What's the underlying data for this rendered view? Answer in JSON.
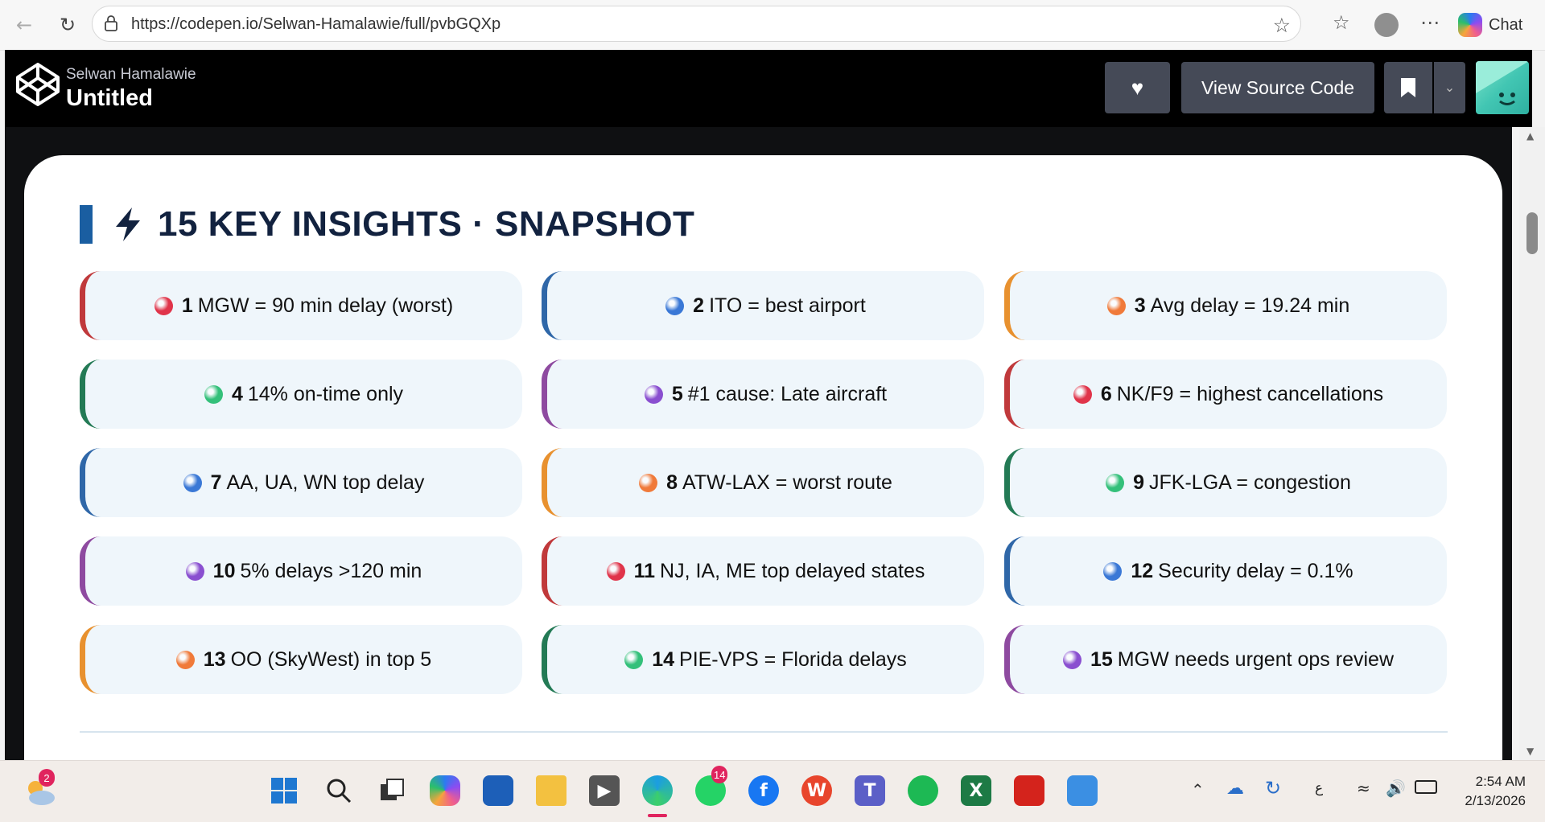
{
  "browser": {
    "url": "https://codepen.io/Selwan-Hamalawie/full/pvbGQXp",
    "chat_label": "Chat"
  },
  "codepen": {
    "author": "Selwan Hamalawie",
    "title": "Untitled",
    "view_source_label": "View Source Code"
  },
  "insights": {
    "heading": "15 KEY INSIGHTS · SNAPSHOT",
    "items": [
      {
        "num": "1",
        "text": "MGW = 90 min delay (worst)",
        "color": "#e0344a"
      },
      {
        "num": "2",
        "text": "ITO = best airport",
        "color": "#3a78d6"
      },
      {
        "num": "3",
        "text": "Avg delay = 19.24 min",
        "color": "#f07a3a"
      },
      {
        "num": "4",
        "text": "14% on-time only",
        "color": "#34c07a"
      },
      {
        "num": "5",
        "text": "#1 cause: Late aircraft",
        "color": "#8a4fd0"
      },
      {
        "num": "6",
        "text": "NK/F9 = highest cancellations",
        "color": "#e0344a"
      },
      {
        "num": "7",
        "text": "AA, UA, WN top delay",
        "color": "#3a78d6"
      },
      {
        "num": "8",
        "text": "ATW-LAX = worst route",
        "color": "#f07a3a"
      },
      {
        "num": "9",
        "text": "JFK-LGA = congestion",
        "color": "#34c07a"
      },
      {
        "num": "10",
        "text": "5% delays >120 min",
        "color": "#8a4fd0"
      },
      {
        "num": "11",
        "text": "NJ, IA, ME top delayed states",
        "color": "#e0344a"
      },
      {
        "num": "12",
        "text": "Security delay = 0.1%",
        "color": "#3a78d6"
      },
      {
        "num": "13",
        "text": "OO (SkyWest) in top 5",
        "color": "#f07a3a"
      },
      {
        "num": "14",
        "text": "PIE-VPS = Florida delays",
        "color": "#34c07a"
      },
      {
        "num": "15",
        "text": "MGW needs urgent ops review",
        "color": "#8a4fd0"
      }
    ],
    "border_colors": [
      "#c0393b",
      "#2f67a8",
      "#e8912f",
      "#237a55",
      "#8e4aa0"
    ]
  },
  "taskbar": {
    "weather_badge": "2",
    "whatsapp_badge": "14",
    "time": "2:54 AM",
    "date": "2/13/2026",
    "lang": "ع"
  }
}
